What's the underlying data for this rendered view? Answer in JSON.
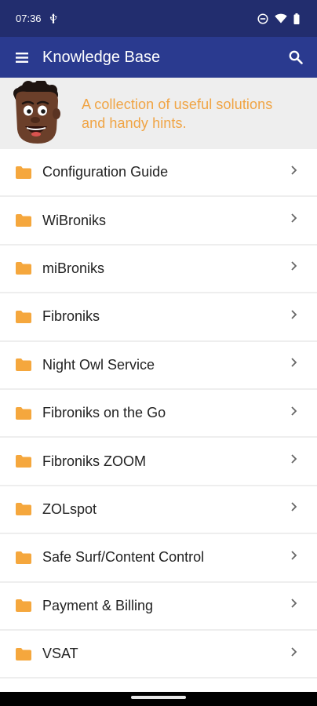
{
  "status_bar": {
    "time": "07:36"
  },
  "app_bar": {
    "title": "Knowledge Base"
  },
  "banner": {
    "text_line1": "A collection of useful solutions",
    "text_line2": "and handy hints."
  },
  "list": {
    "items": [
      {
        "label": "Configuration Guide",
        "icon": "folder-icon"
      },
      {
        "label": "WiBroniks",
        "icon": "folder-icon"
      },
      {
        "label": "miBroniks",
        "icon": "folder-icon"
      },
      {
        "label": "Fibroniks",
        "icon": "folder-icon"
      },
      {
        "label": "Night Owl Service",
        "icon": "folder-icon"
      },
      {
        "label": "Fibroniks on the Go",
        "icon": "folder-icon"
      },
      {
        "label": "Fibroniks ZOOM",
        "icon": "folder-icon"
      },
      {
        "label": "ZOLspot",
        "icon": "folder-icon"
      },
      {
        "label": "Safe Surf/Content Control",
        "icon": "folder-icon"
      },
      {
        "label": "Payment & Billing",
        "icon": "folder-icon"
      },
      {
        "label": "VSAT",
        "icon": "folder-icon"
      }
    ]
  },
  "colors": {
    "status_bar": "#222d6e",
    "app_bar": "#2a3a8f",
    "accent_orange": "#f0a444",
    "folder": "#f5a73d"
  }
}
